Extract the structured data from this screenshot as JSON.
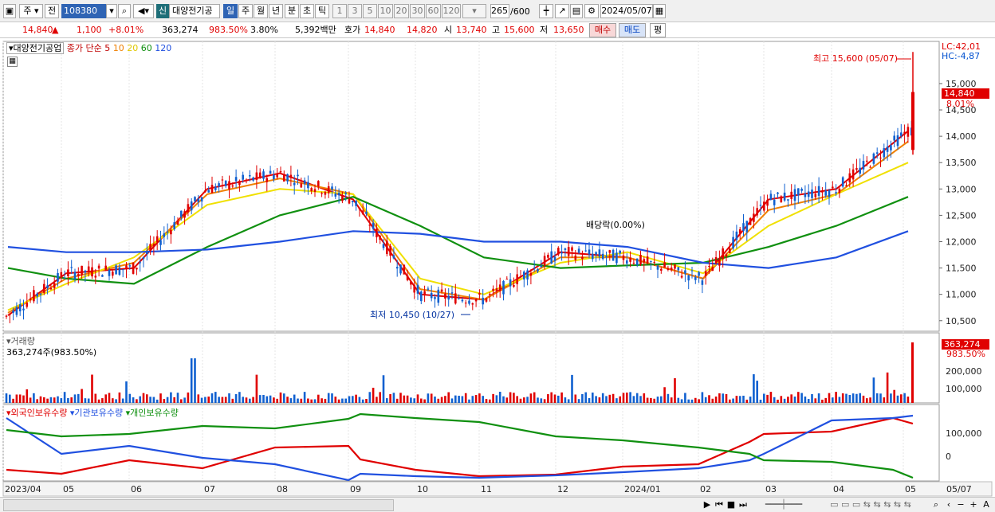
{
  "toolbar": {
    "market": "주",
    "prev": "전",
    "code": "108380",
    "new_badge": "신",
    "stock_name": "대양전기공",
    "periods": [
      "일",
      "주",
      "월",
      "년",
      "분",
      "초",
      "틱"
    ],
    "intervals": [
      "1",
      "3",
      "5",
      "10",
      "20",
      "30",
      "60",
      "120"
    ],
    "count": "265",
    "count_total": "/600",
    "date": "2024/05/07"
  },
  "quote": {
    "price": "14,840",
    "arrow": "▲",
    "change": "1,100",
    "change_pct": "+8.01%",
    "volume": "363,274",
    "vol_ratio": "983.50%",
    "turnover": "3.80%",
    "amount": "5,392백만",
    "ask_label": "호가",
    "ask": "14,840",
    "bid": "14,820",
    "open_label": "시",
    "open": "13,740",
    "high_label": "고",
    "high": "15,600",
    "low_label": "저",
    "low": "13,650",
    "buy": "매수",
    "sell": "매도",
    "eval": "평"
  },
  "legend": {
    "name": "대양전기공업",
    "ma_label": "종가 단순",
    "ma": [
      "5",
      "10",
      "20",
      "60",
      "120"
    ]
  },
  "colors": {
    "ma5": "#e00000",
    "ma10": "#f08000",
    "ma20": "#f0e000",
    "ma60": "#109010",
    "ma120": "#2050e0",
    "up": "#e00000",
    "down": "#1060d0"
  },
  "price_axis": {
    "ticks": [
      "15,000",
      "14,500",
      "14,000",
      "13,500",
      "13,000",
      "12,500",
      "12,000",
      "11,500",
      "11,000",
      "10,500"
    ],
    "lc": "LC:42,01",
    "hc": "HC:-4,87",
    "current": "14,840",
    "current_pct": "8.01%"
  },
  "annotations": {
    "high": "최고 15,600 (05/07)",
    "low": "최저 10,450 (10/27)",
    "dividend": "배당락(0.00%)"
  },
  "volume": {
    "title": "거래량",
    "value": "363,274주(983.50%)",
    "ticks": [
      "200,000",
      "100,000"
    ],
    "current": "363,274",
    "current_pct": "983.50%"
  },
  "holdings": {
    "foreign": "외국인보유수량",
    "inst": "기관보유수량",
    "indiv": "개인보유수량",
    "ticks": [
      "100,000",
      "0"
    ]
  },
  "xaxis": [
    "2023/04",
    "05",
    "06",
    "07",
    "08",
    "09",
    "10",
    "11",
    "12",
    "2024/01",
    "02",
    "03",
    "04",
    "05",
    "05/07"
  ],
  "chart_data": {
    "type": "line",
    "ylim": [
      10300,
      15800
    ],
    "x": [
      "2023/04",
      "05",
      "06",
      "07",
      "08",
      "09",
      "10",
      "11",
      "12",
      "2024/01",
      "02",
      "03",
      "04",
      "05/07"
    ],
    "series": [
      {
        "name": "5",
        "values": [
          10600,
          11400,
          11500,
          13000,
          13300,
          12800,
          11000,
          10900,
          11800,
          11700,
          11300,
          12800,
          13000,
          14100
        ]
      },
      {
        "name": "10",
        "values": [
          10650,
          11300,
          11600,
          12900,
          13200,
          12900,
          11100,
          10900,
          11700,
          11700,
          11300,
          12600,
          12900,
          13900
        ]
      },
      {
        "name": "20",
        "values": [
          10700,
          11200,
          11700,
          12700,
          13000,
          12900,
          11300,
          11000,
          11600,
          11800,
          11400,
          12300,
          12900,
          13500
        ]
      },
      {
        "name": "60",
        "values": [
          11500,
          11300,
          11200,
          11900,
          12500,
          12850,
          12300,
          11700,
          11500,
          11550,
          11600,
          11900,
          12300,
          12850
        ]
      },
      {
        "name": "120",
        "values": [
          11900,
          11800,
          11800,
          11850,
          12000,
          12200,
          12150,
          12000,
          12000,
          11900,
          11600,
          11500,
          11700,
          12200
        ]
      }
    ]
  }
}
